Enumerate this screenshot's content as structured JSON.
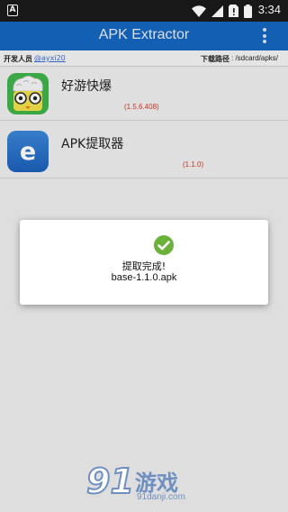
{
  "status_bar": {
    "notification_letter": "A",
    "icons": [
      "wifi-icon",
      "signal-icon",
      "no-sim-icon",
      "battery-icon"
    ],
    "time": "3:34"
  },
  "app_bar": {
    "title": "APK Extractor",
    "menu_icon": "more-vert-icon",
    "color": "#1565c0"
  },
  "info_bar": {
    "developer_label": "开发人员",
    "developer_name": "@ayxi20",
    "path_label": "下载路径",
    "path_value": ": /sdcard/apks/"
  },
  "apps": [
    {
      "name": "好游快爆",
      "version": "(1.5.6.408)",
      "icon": "haoyou-app-icon"
    },
    {
      "name": "APK提取器",
      "version": "(1.1.0)",
      "icon": "apk-extractor-app-icon"
    }
  ],
  "dialog": {
    "icon": "check-circle-icon",
    "title": "提取完成!",
    "file_name": "base-1.1.0.apk",
    "accent": "#6ab23a"
  },
  "watermark": {
    "logo": "91",
    "brand": "游戏",
    "url": "91danji.com"
  }
}
